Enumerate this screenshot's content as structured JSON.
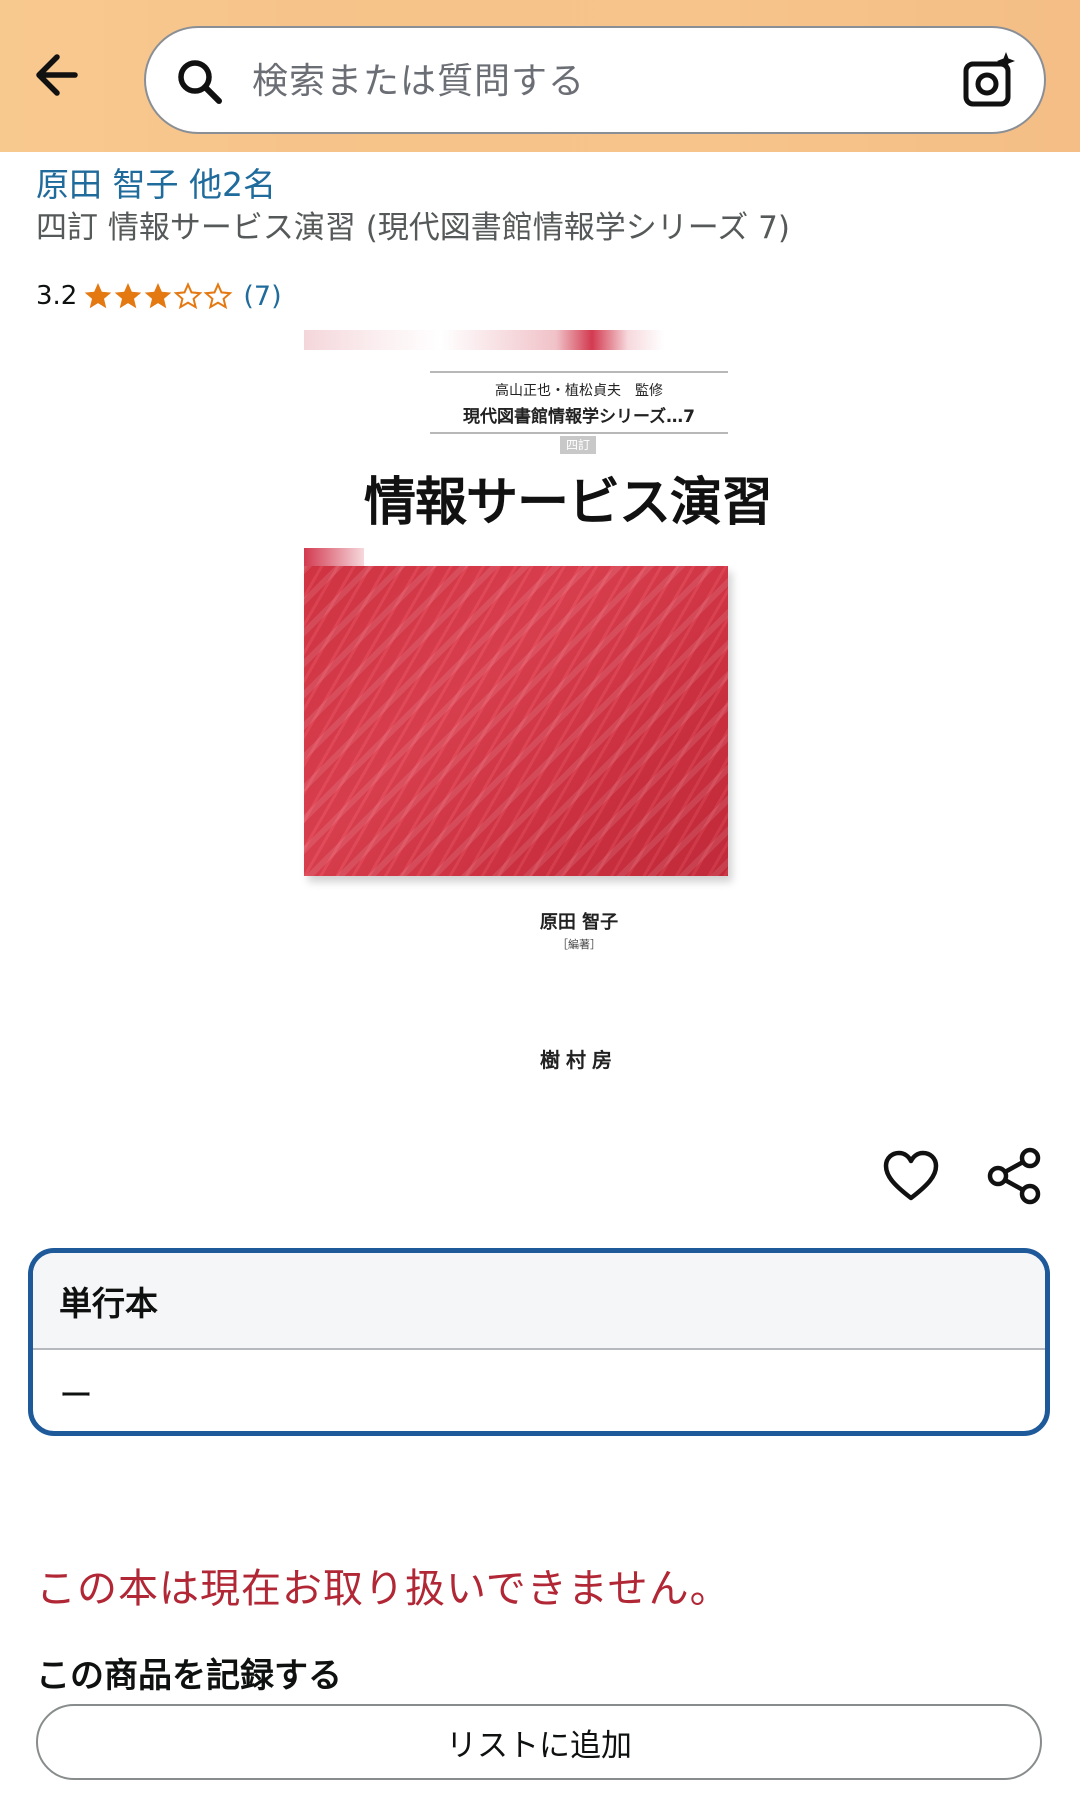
{
  "header": {
    "search_placeholder": "検索または質問する",
    "back_icon": "arrow-left-icon",
    "search_icon": "search-icon",
    "camera_icon": "camera-sparkle-icon"
  },
  "product": {
    "author": "原田 智子 他2名",
    "title": "四訂 情報サービス演習 (現代図書館情報学シリーズ 7)",
    "rating_value": "3.2",
    "rating_stars": 3.2,
    "rating_count": "(7)"
  },
  "cover": {
    "supervisors": "高山正也・植松貞夫　監修",
    "series": "現代図書館情報学シリーズ…7",
    "edition_badge": "四訂",
    "title": "情報サービス演習",
    "author": "原田 智子",
    "author_role": "［編著］",
    "publisher": "樹村房"
  },
  "format": {
    "label": "単行本",
    "price": "ー"
  },
  "availability": {
    "message": "この本は現在お取り扱いできません。"
  },
  "record": {
    "label": "この商品を記録する",
    "add_to_list": "リストに追加"
  },
  "colors": {
    "header_bg": "#f7c48c",
    "link_blue": "#1f6b9c",
    "star_orange": "#e47911",
    "selected_border": "#1e5a9a",
    "unavailable_red": "#b12735"
  }
}
